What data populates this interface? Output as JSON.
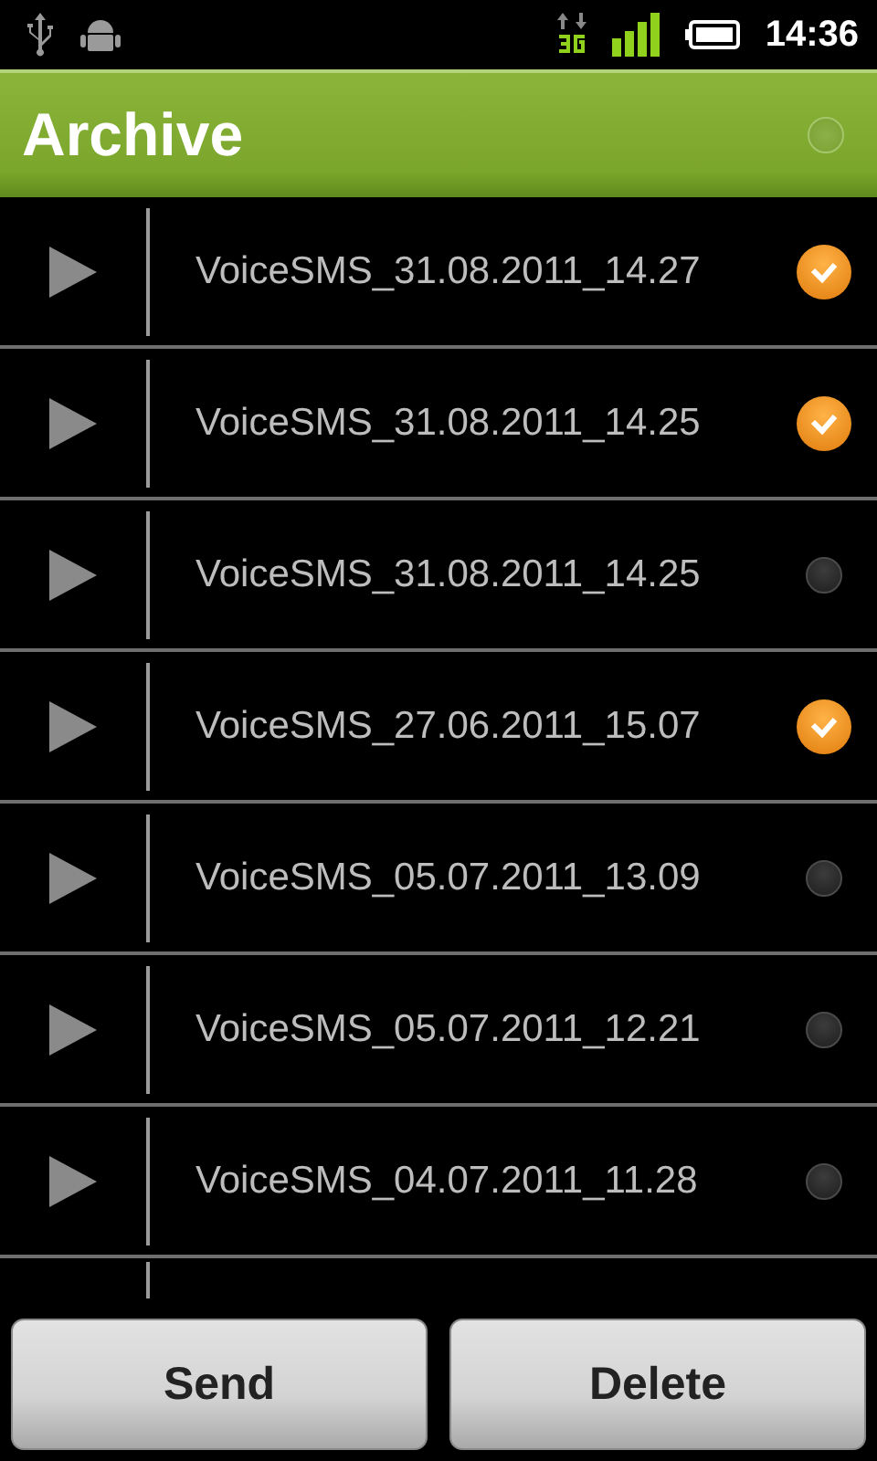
{
  "status_bar": {
    "time": "14:36"
  },
  "header": {
    "title": "Archive",
    "select_all_checked": false
  },
  "items": [
    {
      "name": "VoiceSMS_31.08.2011_14.27",
      "checked": true
    },
    {
      "name": "VoiceSMS_31.08.2011_14.25",
      "checked": true
    },
    {
      "name": "VoiceSMS_31.08.2011_14.25",
      "checked": false
    },
    {
      "name": "VoiceSMS_27.06.2011_15.07",
      "checked": true
    },
    {
      "name": "VoiceSMS_05.07.2011_13.09",
      "checked": false
    },
    {
      "name": "VoiceSMS_05.07.2011_12.21",
      "checked": false
    },
    {
      "name": "VoiceSMS_04.07.2011_11.28",
      "checked": false
    }
  ],
  "buttons": [
    "Send",
    "Delete"
  ]
}
